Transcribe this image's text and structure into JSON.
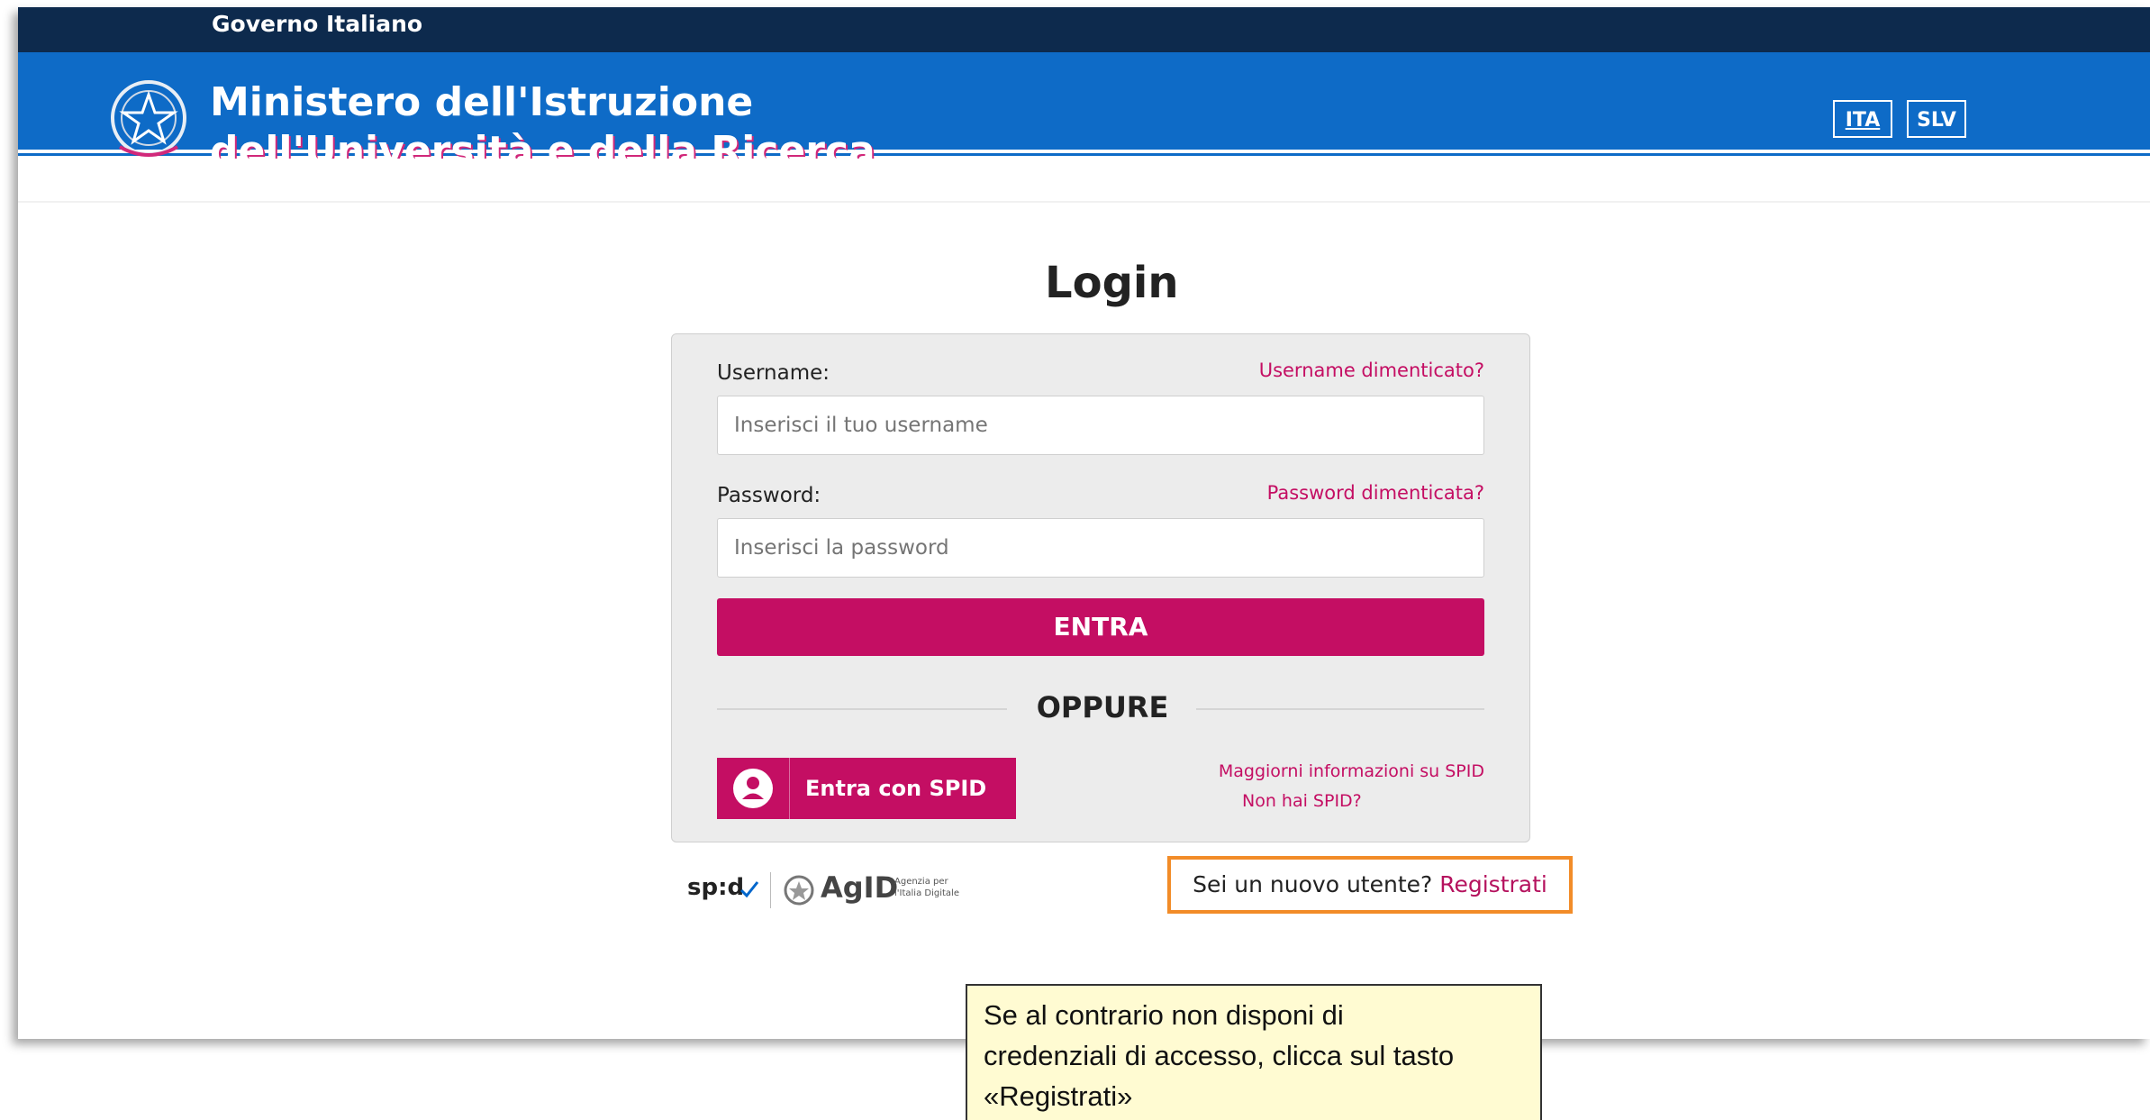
{
  "gov_bar": {
    "label": "Governo Italiano"
  },
  "header": {
    "title_line1": "Ministero dell'Istruzione",
    "title_line2": "dell'Università e della Ricerca",
    "languages": [
      "ITA",
      "SLV"
    ],
    "active_language": "ITA"
  },
  "login": {
    "title": "Login",
    "username_label": "Username:",
    "username_forgot": "Username dimenticato?",
    "username_placeholder": "Inserisci il tuo username",
    "password_label": "Password:",
    "password_forgot": "Password dimenticata?",
    "password_placeholder": "Inserisci la password",
    "submit_label": "ENTRA",
    "or_label": "OPPURE",
    "spid_button_label": "Entra con SPID",
    "spid_more_info": "Maggiorni informazioni su SPID",
    "spid_no_account": "Non hai SPID?"
  },
  "footer": {
    "spid_logo_text": "sp:d",
    "agid_logo_text": "AgID",
    "agid_subtitle_line1": "Agenzia per",
    "agid_subtitle_line2": "l'Italia Digitale",
    "register_prompt": "Sei un nuovo utente?",
    "register_link": "Registrati"
  },
  "tooltip": {
    "lines": [
      "Se al contrario non disponi di",
      "credenziali di accesso,  clicca sul tasto",
      "«Registrati»"
    ]
  },
  "colors": {
    "gov_bar": "#0d2a4d",
    "header": "#0e6bc7",
    "accent": "#c40e63",
    "highlight_border": "#f28c28",
    "tooltip_bg": "#fffbd2"
  }
}
